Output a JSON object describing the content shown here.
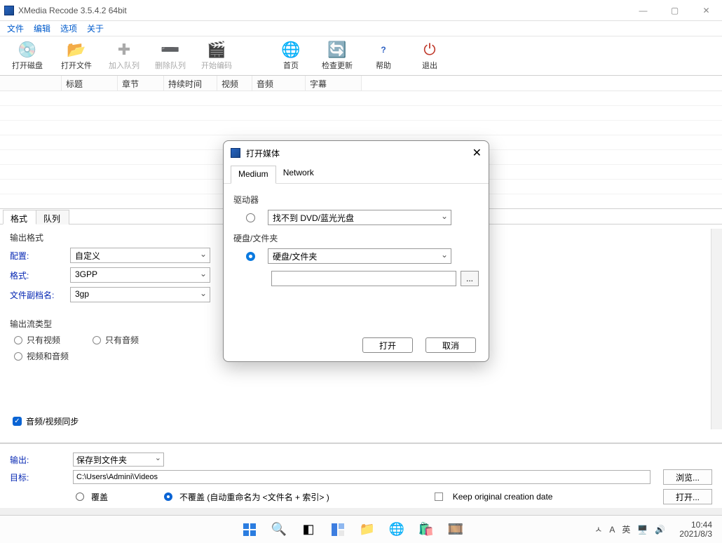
{
  "titlebar": {
    "title": "XMedia Recode 3.5.4.2 64bit"
  },
  "menu": {
    "file": "文件",
    "edit": "编辑",
    "options": "选项",
    "about": "关于"
  },
  "toolbar": {
    "open_disc": "打开磁盘",
    "open_file": "打开文件",
    "add_queue": "加入队列",
    "del_queue": "删除队列",
    "start_enc": "开始编码",
    "home": "首页",
    "check_upd": "检查更新",
    "help": "帮助",
    "exit": "退出"
  },
  "grid": {
    "h1": "标题",
    "h2": "章节",
    "h3": "持续时间",
    "h4": "视频",
    "h5": "音频",
    "h6": "字幕"
  },
  "tabs": {
    "format": "格式",
    "queue": "队列"
  },
  "format_panel": {
    "out_format_label": "输出格式",
    "profile": "配置:",
    "profile_val": "自定义",
    "format": "格式:",
    "format_val": "3GPP",
    "ext": "文件副档名:",
    "ext_val": "3gp",
    "stream_label": "输出流类型",
    "only_video": "只有视频",
    "only_audio": "只有音频",
    "av": "视频和音频",
    "sync": "音频/视频同步"
  },
  "output": {
    "out": "输出:",
    "out_val": "保存到文件夹",
    "target": "目标:",
    "target_val": "C:\\Users\\Admini\\Videos",
    "browse": "浏览...",
    "open": "打开...",
    "overwrite": "覆盖",
    "no_overwrite": "不覆盖 (自动重命名为 <文件名 + 索引> )",
    "keep_date": "Keep original creation date"
  },
  "dialog": {
    "title": "打开媒体",
    "tab_medium": "Medium",
    "tab_network": "Network",
    "drive_label": "驱动器",
    "drive_val": "找不到 DVD/蓝光光盘",
    "hdd_label": "硬盘/文件夹",
    "hdd_val": "硬盘/文件夹",
    "path_val": "",
    "open_btn": "打开",
    "cancel_btn": "取消",
    "browse_dots": "..."
  },
  "tray": {
    "up": "ㅅ",
    "lang1": "A",
    "lang2": "英",
    "time": "10:44",
    "date": "2021/8/3"
  }
}
